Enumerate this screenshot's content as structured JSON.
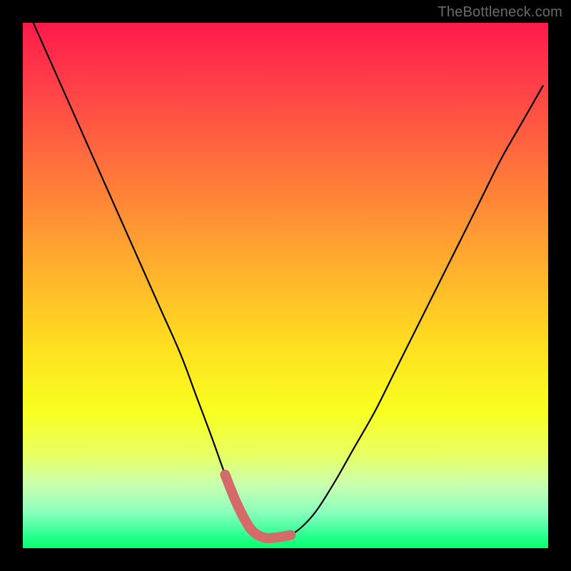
{
  "watermark": "TheBottleneck.com",
  "chart_data": {
    "type": "line",
    "title": "",
    "xlabel": "",
    "ylabel": "",
    "xlim": [
      0,
      100
    ],
    "ylim": [
      0,
      100
    ],
    "background": "rainbow-gradient-red-to-green",
    "series": [
      {
        "name": "main-curve",
        "color": "#000000",
        "x": [
          2,
          6,
          10,
          14,
          18,
          22,
          26,
          30,
          33,
          36,
          38.5,
          40.5,
          42.5,
          44,
          46,
          48,
          51,
          55,
          59,
          63,
          67,
          71,
          75,
          79,
          83,
          87,
          91,
          95,
          99
        ],
        "values": [
          100,
          91,
          82,
          73,
          64,
          55,
          46,
          37,
          29,
          21,
          14,
          9,
          5,
          3,
          2,
          2,
          2.5,
          6,
          12,
          19,
          26,
          34,
          42,
          50,
          58,
          66,
          74,
          81,
          88
        ]
      },
      {
        "name": "bottom-highlight",
        "color": "#d46a6a",
        "x": [
          38.5,
          40.5,
          42.5,
          44,
          46,
          48,
          51
        ],
        "values": [
          14,
          9,
          5,
          3,
          2,
          2,
          2.5
        ]
      }
    ]
  }
}
